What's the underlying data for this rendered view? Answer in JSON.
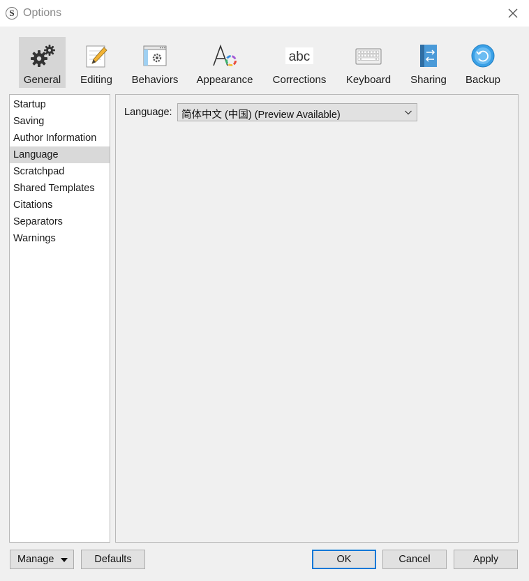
{
  "window": {
    "title": "Options"
  },
  "toolbar": {
    "items": [
      {
        "label": "General",
        "icon": "gears-icon",
        "active": true
      },
      {
        "label": "Editing",
        "icon": "pencil-notepad-icon"
      },
      {
        "label": "Behaviors",
        "icon": "window-gear-icon"
      },
      {
        "label": "Appearance",
        "icon": "font-color-icon"
      },
      {
        "label": "Corrections",
        "icon": "abc-spelling-icon"
      },
      {
        "label": "Keyboard",
        "icon": "keyboard-icon"
      },
      {
        "label": "Sharing",
        "icon": "sync-arrows-icon"
      },
      {
        "label": "Backup",
        "icon": "backup-circle-icon"
      }
    ],
    "corrections_icon_text": "abc"
  },
  "sidebar": {
    "items": [
      {
        "label": "Startup"
      },
      {
        "label": "Saving"
      },
      {
        "label": "Author Information"
      },
      {
        "label": "Language",
        "selected": true
      },
      {
        "label": "Scratchpad"
      },
      {
        "label": "Shared Templates"
      },
      {
        "label": "Citations"
      },
      {
        "label": "Separators"
      },
      {
        "label": "Warnings"
      }
    ]
  },
  "content": {
    "language_label": "Language:",
    "language_value": "简体中文 (中国) (Preview Available)"
  },
  "buttons": {
    "manage": "Manage",
    "defaults": "Defaults",
    "ok": "OK",
    "cancel": "Cancel",
    "apply": "Apply"
  },
  "colors": {
    "accent": "#0078d7",
    "selection": "#d9d9d9",
    "backup_blue": "#3aa0e6"
  }
}
